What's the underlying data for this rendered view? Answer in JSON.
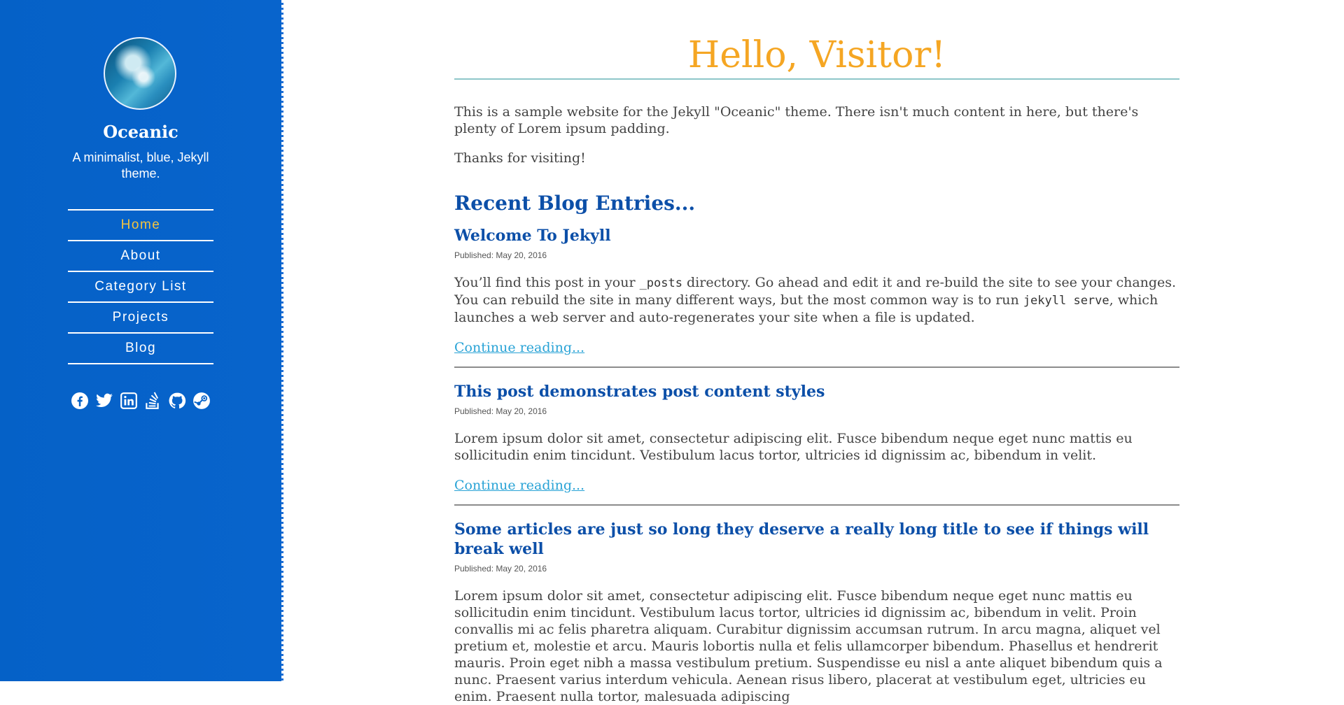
{
  "sidebar": {
    "avatar_icon": "ocean-wave-avatar",
    "title": "Oceanic",
    "tagline": "A minimalist, blue, Jekyll theme.",
    "nav": [
      {
        "label": "Home",
        "active": true
      },
      {
        "label": "About",
        "active": false
      },
      {
        "label": "Category List",
        "active": false
      },
      {
        "label": "Projects",
        "active": false
      },
      {
        "label": "Blog",
        "active": false
      }
    ],
    "social_icons": [
      "facebook-icon",
      "twitter-icon",
      "linkedin-icon",
      "stackoverflow-icon",
      "github-icon",
      "steam-icon"
    ],
    "colors": {
      "background": "#0561c7",
      "active_nav": "#f3c440"
    }
  },
  "main": {
    "heading": "Hello, Visitor!",
    "intro": "This is a sample website for the Jekyll \"Oceanic\" theme. There isn't much content in here, but there's plenty of Lorem ipsum padding.",
    "thanks": "Thanks for visiting!",
    "recent_heading": "Recent Blog Entries...",
    "posts": [
      {
        "title": "Welcome To Jekyll",
        "date": "Published: May 20, 2016",
        "body_parts": [
          "You’ll find this post in your ",
          "_posts",
          " directory. Go ahead and edit it and re-build the site to see your changes. You can rebuild the site in many different ways, but the most common way is to run ",
          "jekyll serve",
          ", which launches a web server and auto-regenerates your site when a file is updated."
        ],
        "continue": "Continue reading..."
      },
      {
        "title": "This post demonstrates post content styles",
        "date": "Published: May 20, 2016",
        "body": "Lorem ipsum dolor sit amet, consectetur adipiscing elit. Fusce bibendum neque eget nunc mattis eu sollicitudin enim tincidunt. Vestibulum lacus tortor, ultricies id dignissim ac, bibendum in velit.",
        "continue": "Continue reading..."
      },
      {
        "title": "Some articles are just so long they deserve a really long title to see if things will break well",
        "date": "Published: May 20, 2016",
        "body": "Lorem ipsum dolor sit amet, consectetur adipiscing elit. Fusce bibendum neque eget nunc mattis eu sollicitudin enim tincidunt. Vestibulum lacus tortor, ultricies id dignissim ac, bibendum in velit. Proin convallis mi ac felis pharetra aliquam. Curabitur dignissim accumsan rutrum. In arcu magna, aliquet vel pretium et, molestie et arcu. Mauris lobortis nulla et felis ullamcorper bibendum. Phasellus et hendrerit mauris. Proin eget nibh a massa vestibulum pretium. Suspendisse eu nisl a ante aliquet bibendum quis a nunc. Praesent varius interdum vehicula. Aenean risus libero, placerat at vestibulum eget, ultricies eu enim. Praesent nulla tortor, malesuada adipiscing"
      }
    ]
  }
}
